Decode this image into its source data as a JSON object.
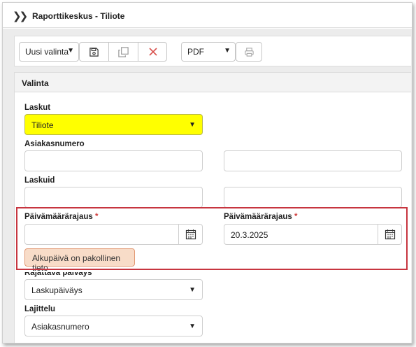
{
  "window": {
    "title": "Raporttikeskus - Tiliote"
  },
  "toolbar": {
    "selection_value": "Uusi valinta",
    "format_value": "PDF"
  },
  "panel": {
    "title": "Valinta"
  },
  "form": {
    "laskut": {
      "label": "Laskut",
      "value": "Tiliote"
    },
    "asiakasnumero": {
      "label": "Asiakasnumero"
    },
    "laskuid": {
      "label": "Laskuid"
    },
    "date_start": {
      "label": "Päivämäärärajaus",
      "required": "*",
      "value": ""
    },
    "date_end": {
      "label": "Päivämäärärajaus",
      "required": "*",
      "value": "20.3.2025"
    },
    "error_message": "Alkupäivä on pakollinen tieto",
    "rajattava_paivays": {
      "label": "Rajattava päiväys",
      "value": "Laskupäiväys"
    },
    "lajittelu": {
      "label": "Lajittelu",
      "value": "Asiakasnumero"
    }
  },
  "icons": {
    "expand": "double-chevron-right-icon",
    "save": "save-icon",
    "copy": "copy-icon",
    "delete": "close-icon",
    "print": "print-icon",
    "calendar": "calendar-icon"
  },
  "colors": {
    "highlight_border": "#c7353f",
    "required_star": "#d04040",
    "selected_field": "#ffff00",
    "error_bg": "#f8dcc8",
    "delete_icon": "#d9534f"
  }
}
